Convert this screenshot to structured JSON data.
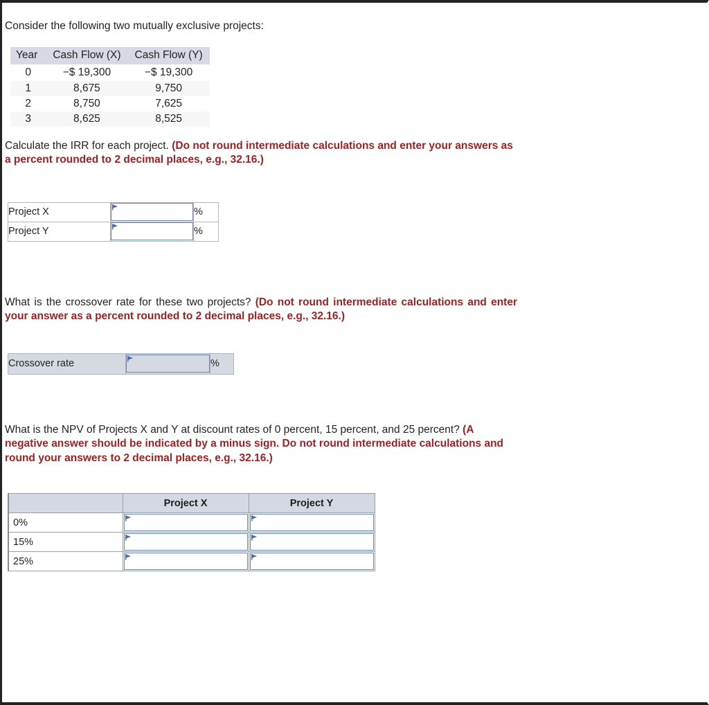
{
  "intro": {
    "text": "Consider the following two mutually exclusive projects:"
  },
  "cash_flow_table": {
    "headers": [
      "Year",
      "Cash Flow (X)",
      "Cash Flow (Y)"
    ],
    "rows": [
      {
        "year": "0",
        "x": "−$ 19,300",
        "y": "−$ 19,300"
      },
      {
        "year": "1",
        "x": "8,675",
        "y": "9,750"
      },
      {
        "year": "2",
        "x": "8,750",
        "y": "7,625"
      },
      {
        "year": "3",
        "x": "8,625",
        "y": "8,525"
      }
    ]
  },
  "irr_section": {
    "prompt_plain": "Calculate the IRR for each project. ",
    "prompt_bold": "(Do not round intermediate calculations and enter your answers as a percent rounded to 2 decimal places, e.g., 32.16.)",
    "rows": [
      {
        "label": "Project X",
        "value": "",
        "unit": "%"
      },
      {
        "label": "Project Y",
        "value": "",
        "unit": "%"
      }
    ]
  },
  "crossover_section": {
    "prompt_plain": "What is the crossover rate for these two projects? ",
    "prompt_bold": "(Do not round intermediate calculations and enter your answer as a percent rounded to 2 decimal places, e.g., 32.16.)",
    "row": {
      "label": "Crossover rate",
      "value": "",
      "unit": "%"
    }
  },
  "npv_section": {
    "prompt_plain": "What is the NPV of Projects X and Y at discount rates of 0 percent, 15 percent, and 25 percent? ",
    "prompt_bold": "(A negative answer should be indicated by a minus sign. Do not round intermediate calculations and round your answers to 2 decimal places, e.g., 32.16.)",
    "headers": [
      "",
      "Project X",
      "Project Y"
    ],
    "rows": [
      {
        "label": "0%",
        "x": "",
        "y": ""
      },
      {
        "label": "15%",
        "x": "",
        "y": ""
      },
      {
        "label": "25%",
        "x": "",
        "y": ""
      }
    ]
  },
  "colors": {
    "accent_red": "#9c2222",
    "field_border": "#6b82b4",
    "header_bg": "#d4d8e3",
    "crossover_bg": "#d5d9e2",
    "alt_row_bg": "#f7f7f7"
  },
  "input_placeholder": ""
}
